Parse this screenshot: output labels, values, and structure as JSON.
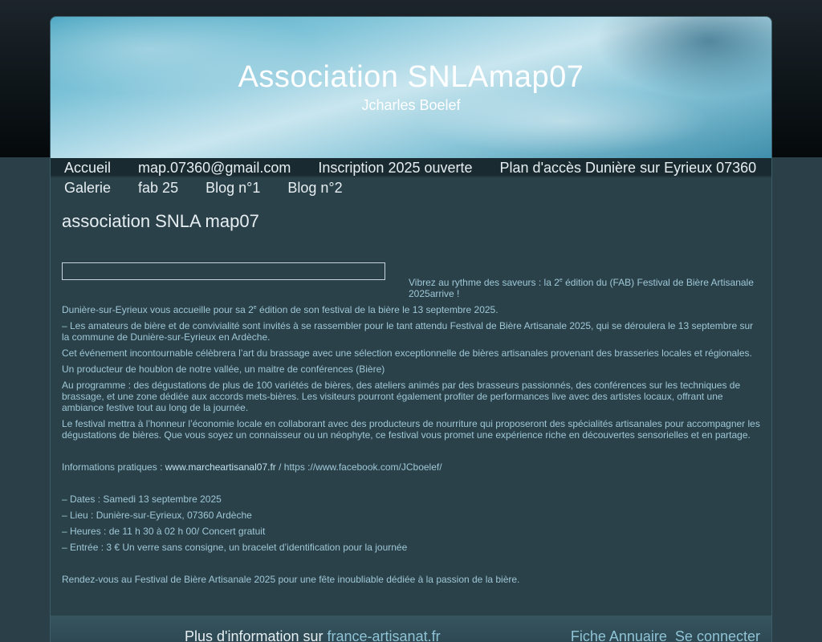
{
  "header": {
    "title": "Association SNLAmap07",
    "subtitle": "Jcharles Boelef"
  },
  "nav": {
    "row1": [
      "Accueil",
      "map.07360@gmail.com",
      "Inscription 2025 ouverte",
      "Plan d'accès Dunière sur Eyrieux 07360"
    ],
    "row2": [
      "Galerie",
      "fab 25",
      "Blog n°1",
      "Blog n°2"
    ]
  },
  "content": {
    "page_title": "association SNLA map07",
    "intro": {
      "before_sup": "Vibrez au rythme des saveurs : la 2",
      "sup": "e",
      "after_sup": " édition du (FAB) Festival de Bière Artisanale 2025arrive !"
    },
    "welcome": {
      "before_sup": " Dunière-sur-Eyrieux vous accueille pour sa 2",
      "sup": "e",
      "after_sup": " édition de son festival de la bière le 13 septembre 2025."
    },
    "paragraphs": [
      "– Les amateurs de bière et de convivialité sont invités à se rassembler pour le tant attendu Festival de Bière Artisanale 2025, qui se déroulera le 13 septembre sur la commune de Dunière-sur-Eyrieux en Ardèche.",
      "Cet événement incontournable célèbrera l’art du brassage avec une sélection exceptionnelle de bières artisanales provenant des brasseries locales et régionales.",
      "Un producteur de houblon de notre vallée, un maitre de conférences (Bière)",
      "Au programme : des dégustations de plus de 100 variétés de bières, des ateliers animés par des brasseurs passionnés, des conférences sur les techniques de brassage, et une zone dédiée aux accords mets-bières. Les visiteurs pourront également profiter de performances live avec des artistes locaux, offrant une ambiance festive tout au long de la journée.",
      "Le festival mettra à l’honneur l’économie locale en collaborant avec des producteurs de nourriture qui proposeront des spécialités artisanales pour accompagner les dégustations de bières. Que vous soyez un connaisseur ou un néophyte, ce festival vous promet une expérience riche en découvertes sensorielles et en partage."
    ],
    "info": {
      "label": "Informations pratiques : ",
      "link1": "www.marcheartisanal07.fr",
      "separator": " / https ://www.facebook.com/JCboelef/"
    },
    "details": [
      "– Dates : Samedi 13 septembre 2025",
      "– Lieu : Dunière-sur-Eyrieux, 07360 Ardèche",
      "– Heures : de 11 h 30 à 02 h 00/   Concert gratuit",
      "– Entrée : 3 € Un verre sans consigne, un bracelet d’identification pour la journée"
    ],
    "closing": "Rendez-vous au Festival de Bière Artisanale 2025 pour une fête inoubliable dédiée à la passion de la bière."
  },
  "footer": {
    "info_prefix": "Plus d'information sur ",
    "info_link": "france-artisanat.fr",
    "annuaire": "Fiche Annuaire",
    "login": "Se connecter"
  }
}
